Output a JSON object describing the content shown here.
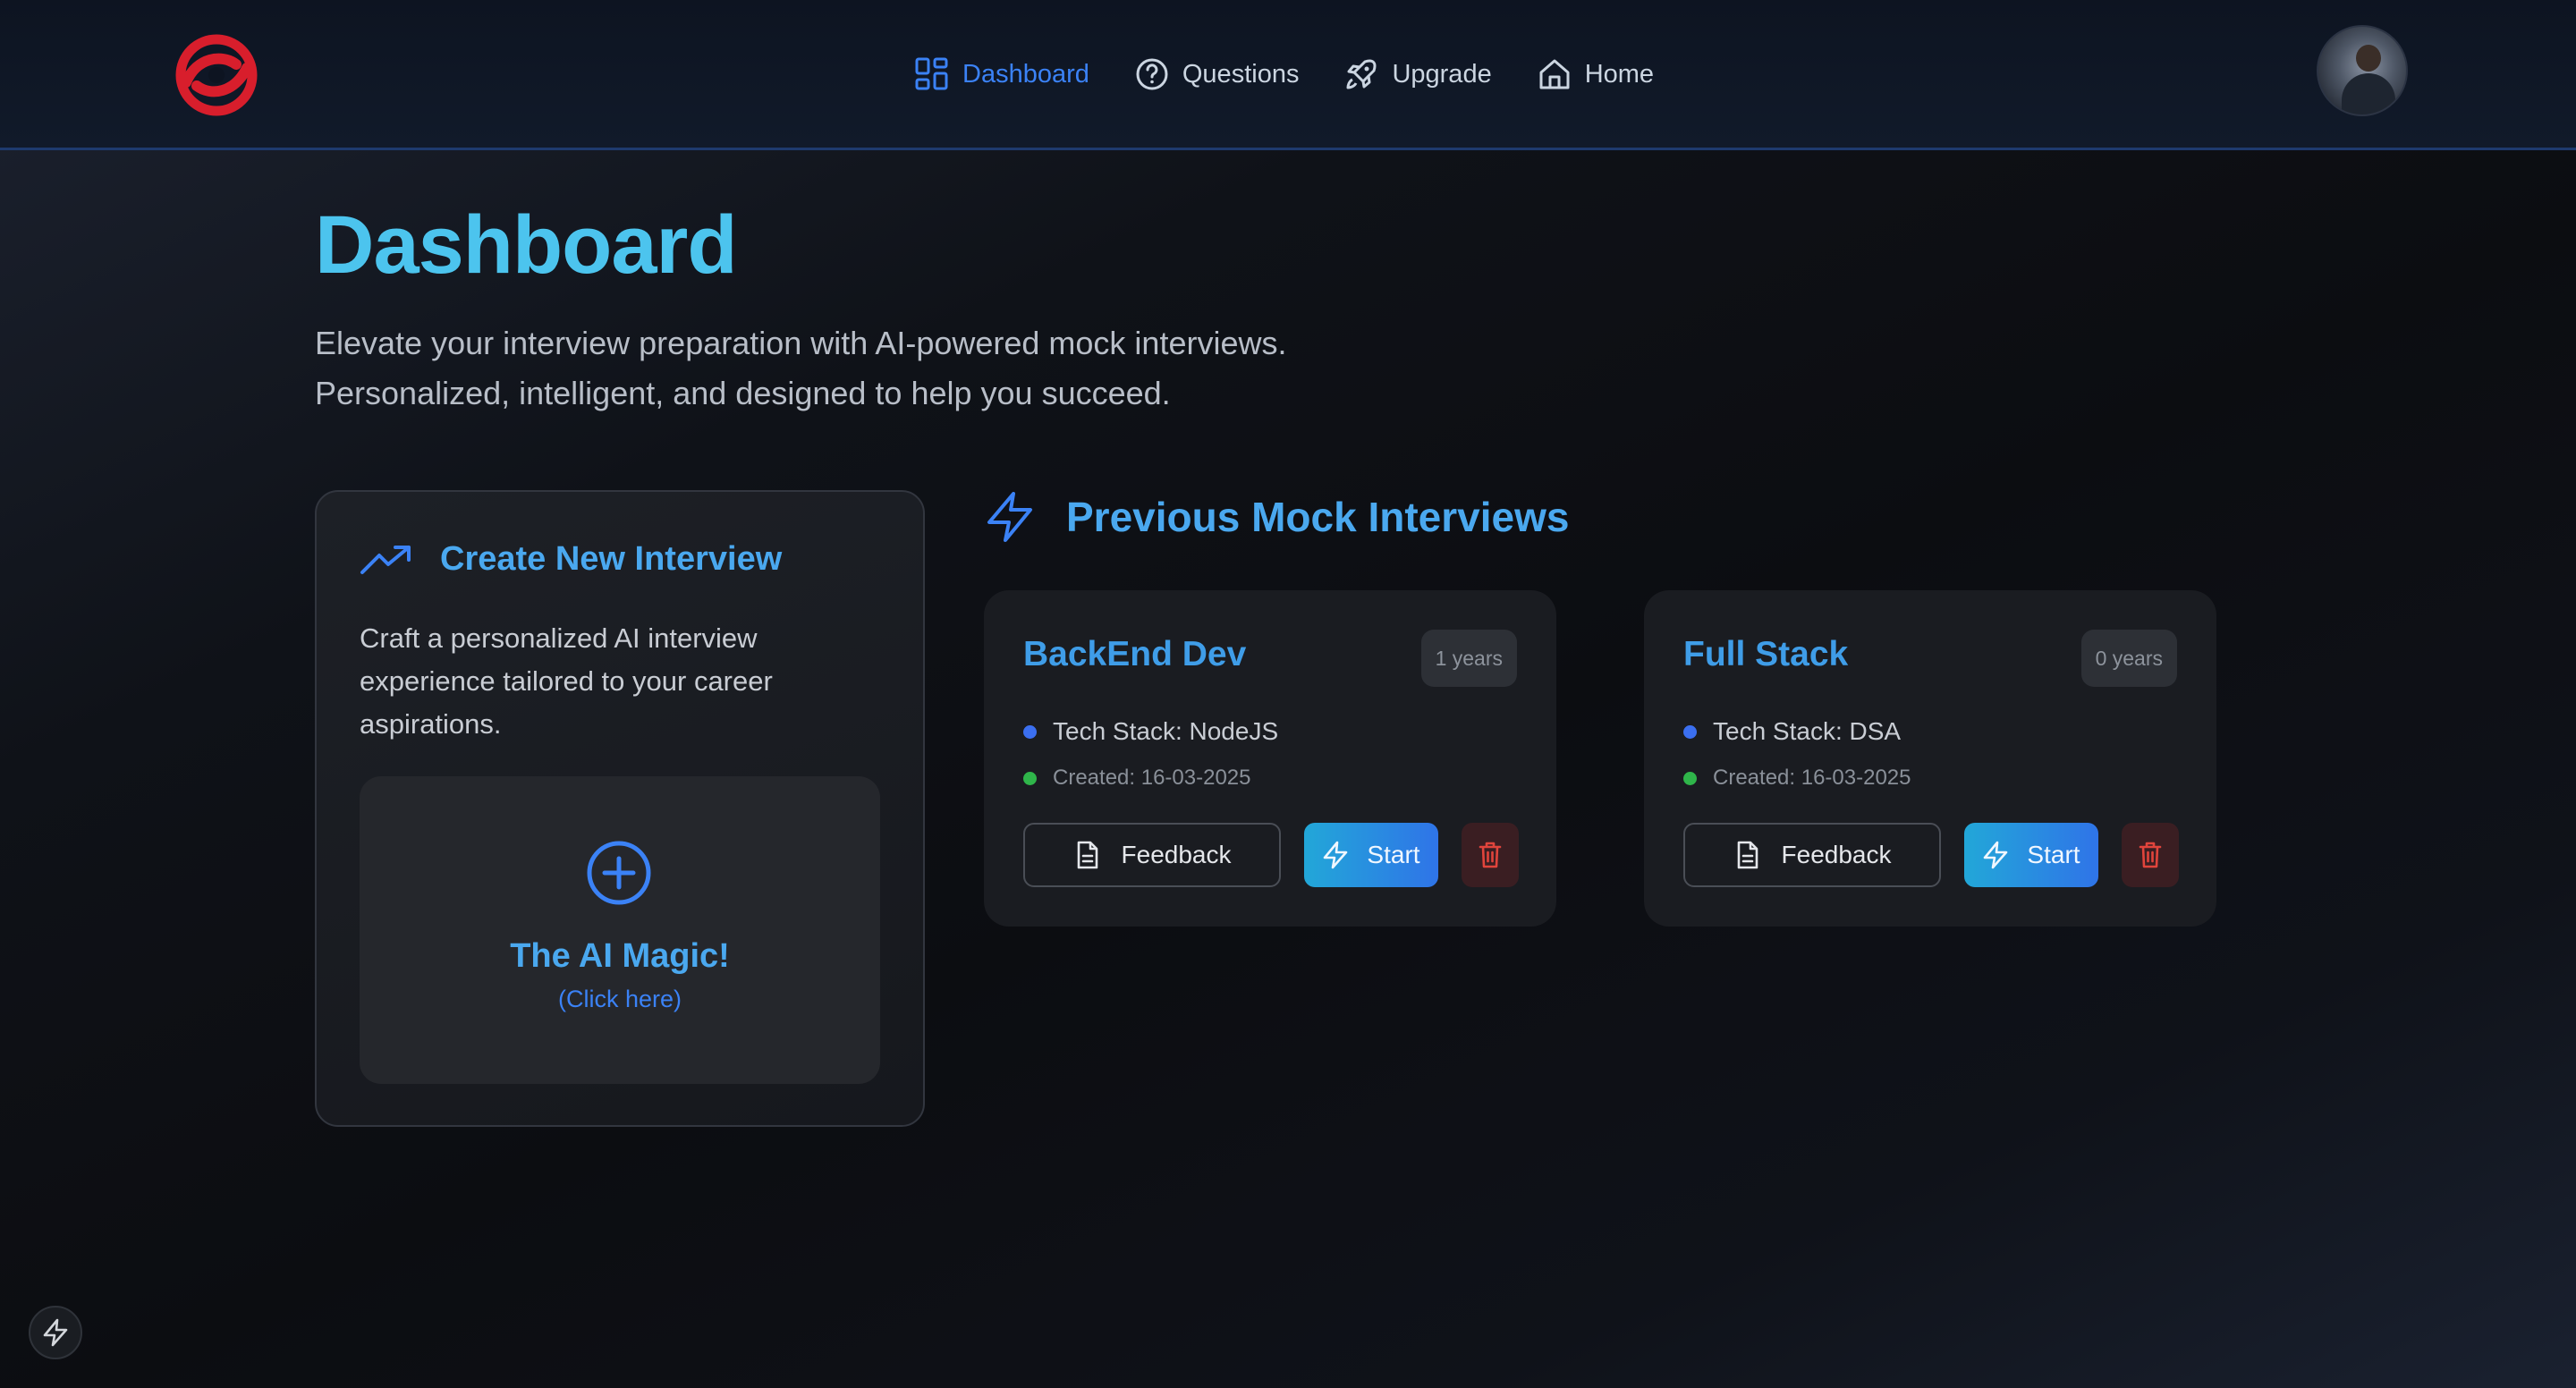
{
  "nav": {
    "items": [
      {
        "label": "Dashboard",
        "icon": "dashboard-grid-icon",
        "active": true
      },
      {
        "label": "Questions",
        "icon": "question-circle-icon",
        "active": false
      },
      {
        "label": "Upgrade",
        "icon": "rocket-icon",
        "active": false
      },
      {
        "label": "Home",
        "icon": "home-icon",
        "active": false
      }
    ]
  },
  "page": {
    "title": "Dashboard",
    "subtitle_line1": "Elevate your interview preparation with AI-powered mock interviews.",
    "subtitle_line2": "Personalized, intelligent, and designed to help you succeed."
  },
  "create": {
    "title": "Create New Interview",
    "description": "Craft a personalized AI interview experience tailored to your career aspirations.",
    "magic_title": "The AI Magic!",
    "magic_sub": "(Click here)"
  },
  "previous": {
    "title": "Previous Mock Interviews",
    "interviews": [
      {
        "title": "BackEnd Dev",
        "experience": "1 years",
        "tech_stack": "Tech Stack: NodeJS",
        "created": "Created: 16-03-2025",
        "feedback_label": "Feedback",
        "start_label": "Start"
      },
      {
        "title": "Full Stack",
        "experience": "0 years",
        "tech_stack": "Tech Stack: DSA",
        "created": "Created: 16-03-2025",
        "feedback_label": "Feedback",
        "start_label": "Start"
      }
    ]
  },
  "colors": {
    "accent": "#3b82f6",
    "title_cyan": "#4cc4ee",
    "tech_dot": "#3b6ff0",
    "created_dot": "#2fb54a",
    "logo_red": "#d81e2c",
    "delete_red": "#e0443c"
  }
}
